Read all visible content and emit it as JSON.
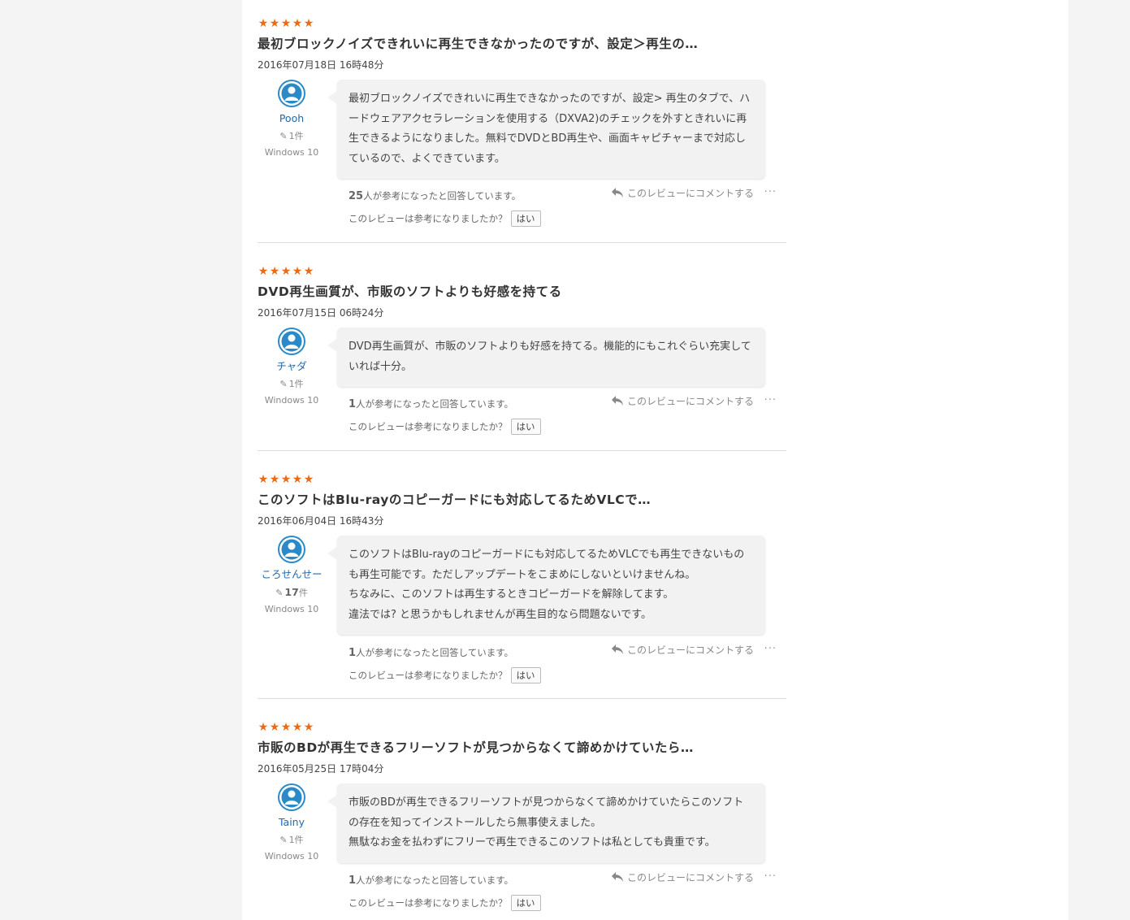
{
  "colors": {
    "star": "#ee6a12",
    "author_link": "#2469a8",
    "avatar": "#2a8ac9"
  },
  "ui": {
    "comment_link": "このレビューにコメントする",
    "helpful_suffix": "人が参考になったと回答しています。",
    "ask_text": "このレビューは参考になりましたか？",
    "yes_label": "はい",
    "more_icon": "more-icon",
    "reply_icon": "reply-icon",
    "edit_icon": "edit-icon"
  },
  "reviews": [
    {
      "rating": 5,
      "title": "最初ブロックノイズできれいに再生できなかったのですが、設定＞再生の…",
      "date": "2016年07月18日 16時48分",
      "author": "Pooh",
      "review_count": "1",
      "review_count_unit": "件",
      "os": "Windows 10",
      "body": [
        "最初ブロックノイズできれいに再生できなかったのですが、設定> 再生のタブで、ハードウェアアクセラレーションを使用する（DXVA2)のチェックを外すときれいに再生できるようになりました。無料でDVDとBD再生や、画面キャピチャーまで対応しているので、よくできています。"
      ],
      "helpful_count": "25"
    },
    {
      "rating": 5,
      "title": "DVD再生画質が、市販のソフトよりも好感を持てる",
      "date": "2016年07月15日 06時24分",
      "author": "チャダ",
      "review_count": "1",
      "review_count_unit": "件",
      "os": "Windows 10",
      "body": [
        "DVD再生画質が、市販のソフトよりも好感を持てる。機能的にもこれぐらい充実していれば十分。"
      ],
      "helpful_count": "1"
    },
    {
      "rating": 5,
      "title": "このソフトはBlu-rayのコピーガードにも対応してるためVLCで…",
      "date": "2016年06月04日 16時43分",
      "author": "ころせんせー",
      "review_count": "17",
      "review_count_unit": "件",
      "os": "Windows 10",
      "body": [
        "このソフトはBlu-rayのコピーガードにも対応してるためVLCでも再生できないものも再生可能です。ただしアップデートをこまめにしないといけませんね。",
        "ちなみに、このソフトは再生するときコピーガードを解除してます。",
        "違法では? と思うかもしれませんが再生目的なら問題ないです。"
      ],
      "helpful_count": "1"
    },
    {
      "rating": 5,
      "title": "市販のBDが再生できるフリーソフトが見つからなくて諦めかけていたら…",
      "date": "2016年05月25日 17時04分",
      "author": "Tainy",
      "review_count": "1",
      "review_count_unit": "件",
      "os": "Windows 10",
      "body": [
        "市販のBDが再生できるフリーソフトが見つからなくて諦めかけていたらこのソフトの存在を知ってインストールしたら無事使えました。",
        "無駄なお金を払わずにフリーで再生できるこのソフトは私としても貴重です。"
      ],
      "helpful_count": "1"
    }
  ]
}
